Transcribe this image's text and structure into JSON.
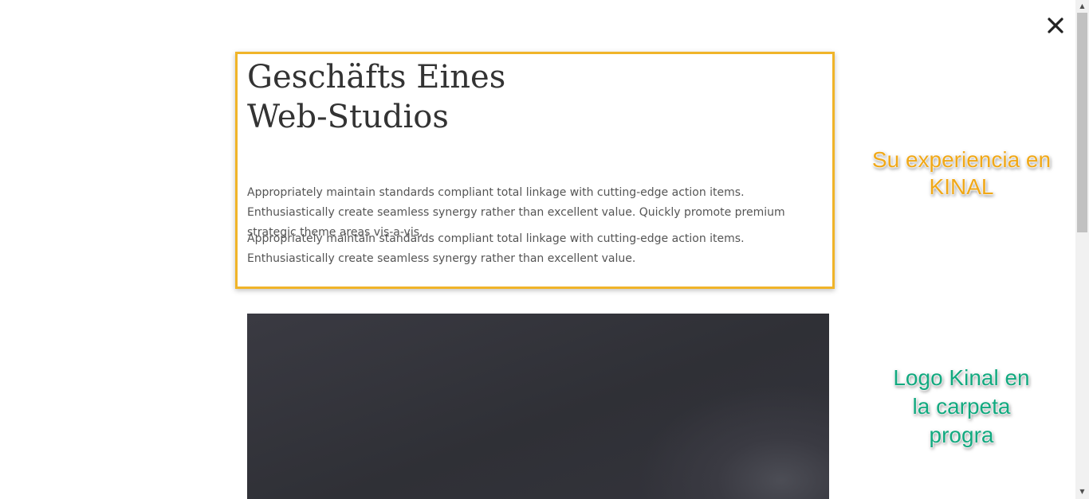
{
  "modal": {
    "title_line1": "Geschäfts Eines",
    "title_line2": "Web-Studios",
    "paragraph1": "Appropriately maintain standards compliant total linkage with cutting-edge action items. Enthusiastically create seamless synergy rather than excellent value. Quickly promote premium strategic theme areas vis-a-vis.",
    "paragraph2": "Appropriately maintain standards compliant total linkage with cutting-edge action items. Enthusiastically create seamless synergy rather than excellent value.",
    "close_icon": "close-icon"
  },
  "annotations": {
    "orange_line1": "Su experiencia en",
    "orange_line2": "KINAL",
    "green_line1": "Logo Kinal en",
    "green_line2": "la carpeta",
    "green_line3": "progra"
  },
  "colors": {
    "highlight_border": "#f0b429",
    "annotation_orange": "#f0a818",
    "annotation_green": "#12a97f",
    "image_dark": "#33333c"
  }
}
